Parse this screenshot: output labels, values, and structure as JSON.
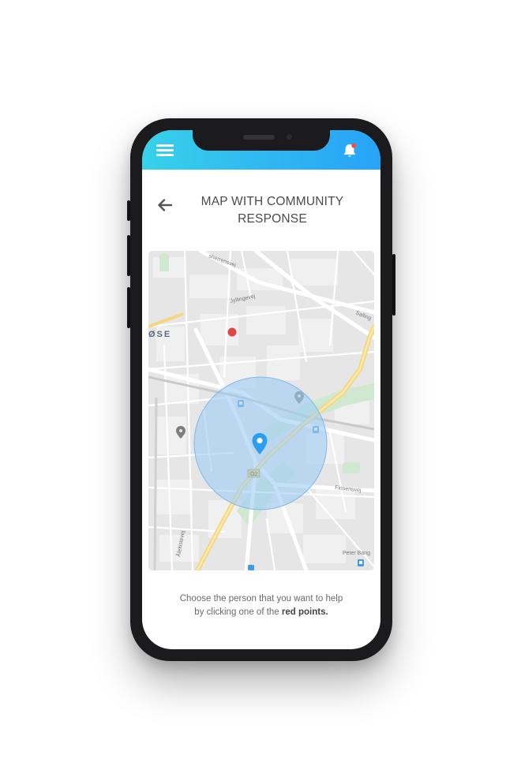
{
  "header": {
    "menu_icon": "hamburger-menu-icon",
    "bell_icon": "bell-icon",
    "notification_dot_color": "#ff4b4b",
    "gradient": [
      "#37d2ea",
      "#27a3f8"
    ]
  },
  "page": {
    "title_line1": "MAP WITH COMMUNITY",
    "title_line2": "RESPONSE",
    "back_icon": "arrow-left-icon"
  },
  "map": {
    "street_labels": {
      "top": "sherrensvej",
      "jyllingevej": "Jyllingevej",
      "salling": "Salling",
      "district": "ØSE",
      "finsensvej": "Finsensvej",
      "peter_bang": "Peter Bang",
      "alekistevej": "Ålekistevej"
    },
    "road_badge": "O2",
    "red_point_color": "#e04848",
    "user_pin_color": "#2b9ef0",
    "radius_fill": "#9fcdf3"
  },
  "instruction": {
    "text_before": "Choose the person that you want to help",
    "text_line2_prefix": "by clicking one of the ",
    "highlight": "red points",
    "suffix": "."
  }
}
